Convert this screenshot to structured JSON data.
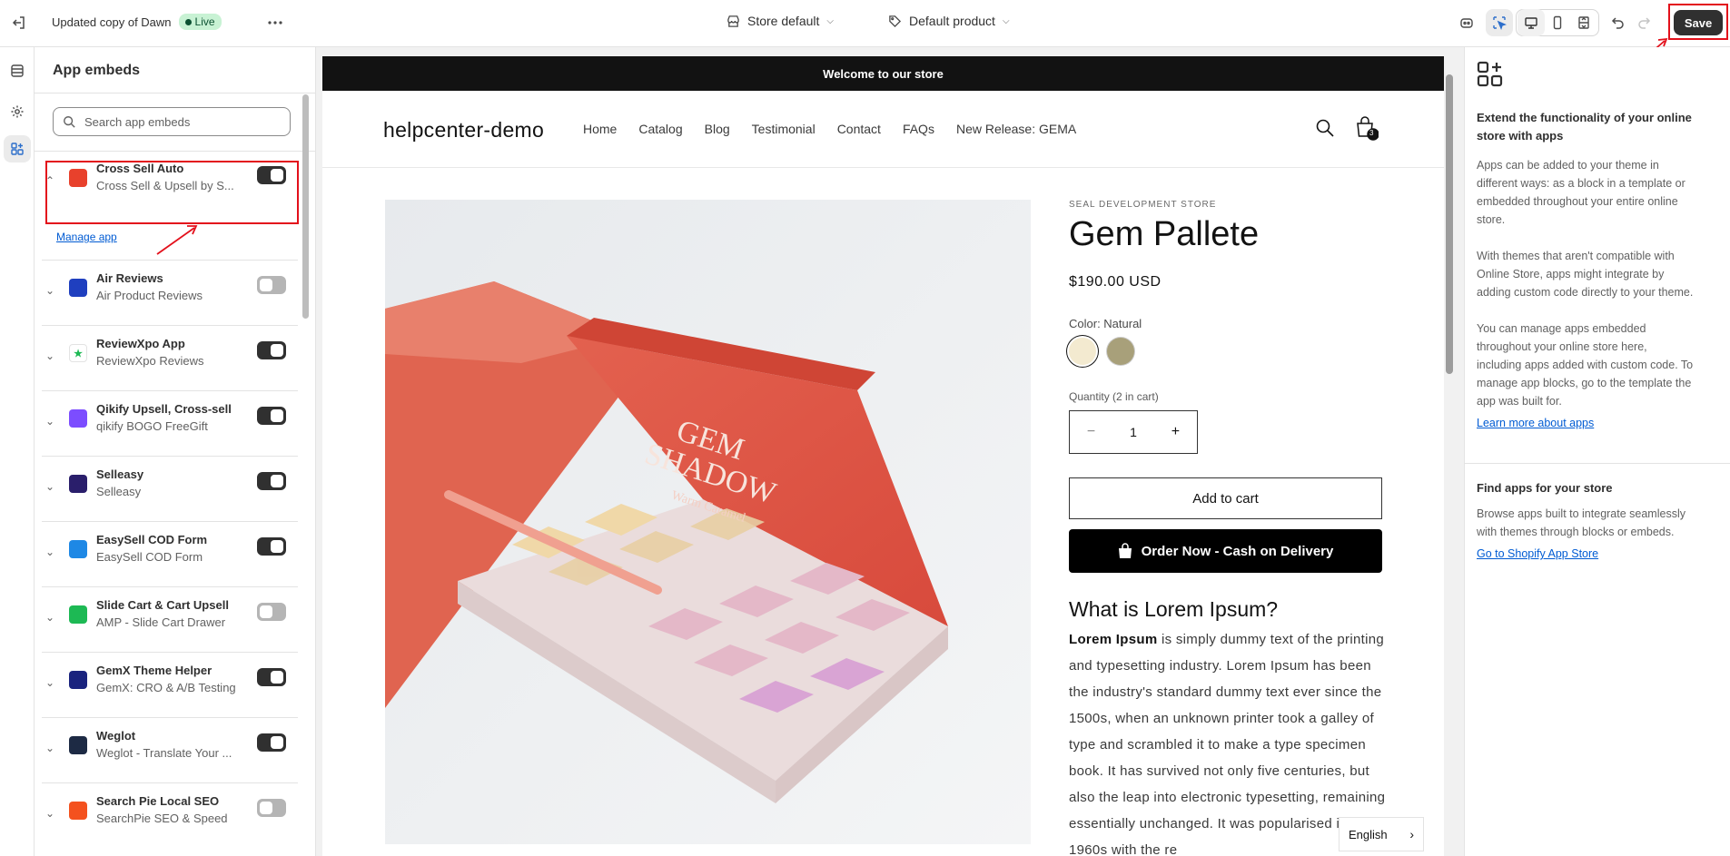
{
  "topbar": {
    "theme_name": "Updated copy of Dawn",
    "live_label": "Live",
    "store_selector": "Store default",
    "product_selector": "Default product",
    "save_label": "Save"
  },
  "left_panel": {
    "title": "App embeds",
    "search_placeholder": "Search app embeds",
    "manage_app_label": "Manage app",
    "apps": [
      {
        "name": "Cross Sell Auto",
        "subtitle": "Cross Sell & Upsell by S...",
        "enabled": true,
        "icon_color": "#e8412c",
        "icon": "cross-sell-icon"
      },
      {
        "name": "Air Reviews",
        "subtitle": "Air Product Reviews",
        "enabled": false,
        "icon_color": "#1f3fbf",
        "icon": "air-reviews-icon"
      },
      {
        "name": "ReviewXpo App",
        "subtitle": "ReviewXpo Reviews",
        "enabled": true,
        "icon_color": "#ffffff",
        "icon": "star-icon"
      },
      {
        "name": "Qikify Upsell, Cross-sell",
        "subtitle": "qikify BOGO FreeGift",
        "enabled": true,
        "icon_color": "#7c4dff",
        "icon": "qikify-icon"
      },
      {
        "name": "Selleasy",
        "subtitle": "Selleasy",
        "enabled": true,
        "icon_color": "#2a1e6b",
        "icon": "selleasy-icon"
      },
      {
        "name": "EasySell COD Form",
        "subtitle": "EasySell COD Form",
        "enabled": true,
        "icon_color": "#1e88e5",
        "icon": "form-icon"
      },
      {
        "name": "Slide Cart & Cart Upsell",
        "subtitle": "AMP - Slide Cart Drawer",
        "enabled": false,
        "icon_color": "#1db954",
        "icon": "slide-cart-icon"
      },
      {
        "name": "GemX Theme Helper",
        "subtitle": "GemX: CRO & A/B Testing",
        "enabled": true,
        "icon_color": "#1a237e",
        "icon": "gemx-icon"
      },
      {
        "name": "Weglot",
        "subtitle": "Weglot - Translate Your ...",
        "enabled": true,
        "icon_color": "#1d2a44",
        "icon": "weglot-icon"
      },
      {
        "name": "Search Pie Local SEO",
        "subtitle": "SearchPie SEO & Speed",
        "enabled": false,
        "icon_color": "#f4511e",
        "icon": "searchpie-icon"
      }
    ]
  },
  "storefront": {
    "announcement": "Welcome to our store",
    "logo": "helpcenter-demo",
    "nav": [
      "Home",
      "Catalog",
      "Blog",
      "Testimonial",
      "Contact",
      "FAQs",
      "New Release: GEMA"
    ],
    "cart_count": "3",
    "vendor": "SEAL DEVELOPMENT STORE",
    "product_title": "Gem Pallete",
    "price": "$190.00 USD",
    "color_label": "Color: Natural",
    "swatch_colors": [
      "#f3ead0",
      "#a8a07a"
    ],
    "quantity_label": "Quantity (2 in cart)",
    "quantity": "1",
    "add_to_cart": "Add to cart",
    "cod_button": "Order Now - Cash on Delivery",
    "desc_heading": "What is Lorem Ipsum?",
    "desc_bold": "Lorem Ipsum",
    "desc_text": " is simply dummy text of the printing and typesetting industry. Lorem Ipsum has been the industry's standard dummy text ever since the 1500s, when an unknown printer took a galley of type and scrambled it to make a type specimen book. It has survived not only five centuries, but also the leap into electronic typesetting, remaining essentially unchanged. It was popularised in the 1960s with the re",
    "image_text_1": "GEM",
    "image_text_2": "SHADOW",
    "image_text_3": "Warm Caramel",
    "language": "English"
  },
  "right_panel": {
    "h1": "Extend the functionality of your online store with apps",
    "p1": "Apps can be added to your theme in different ways: as a block in a template or embedded throughout your entire online store.",
    "p2": "With themes that aren't compatible with Online Store, apps might integrate by adding custom code directly to your theme.",
    "p3": "You can manage apps embedded throughout your online store here, including apps added with custom code. To manage app blocks, go to the template the app was built for.",
    "link1": "Learn more about apps",
    "h2": "Find apps for your store",
    "p4": "Browse apps built to integrate seamlessly with themes through blocks or embeds.",
    "link2": "Go to Shopify App Store"
  }
}
